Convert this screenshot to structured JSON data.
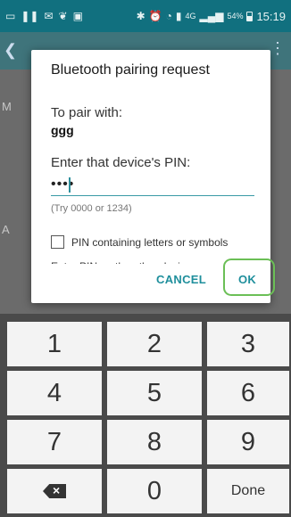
{
  "status_bar": {
    "left_icons": [
      "cast-icon",
      "pause-icon",
      "mail-icon",
      "leaf-icon",
      "screenshot-icon"
    ],
    "right_icons": [
      "bluetooth-icon",
      "alarm-icon",
      "wifi-icon",
      "sim-icon"
    ],
    "network": "4G",
    "battery": "54%",
    "time": "15:19"
  },
  "background": {
    "letter_m": "M",
    "letter_a": "A"
  },
  "dialog": {
    "title": "Bluetooth pairing request",
    "pair_label": "To pair with:",
    "device_name": "ggg",
    "pin_prompt": "Enter that device's PIN:",
    "pin_value": "••••",
    "hint": "(Try 0000 or 1234)",
    "checkbox_label": "PIN containing letters or symbols",
    "cutoff_text": "Enter PIN on the other device",
    "cancel_label": "CANCEL",
    "ok_label": "OK"
  },
  "keypad": {
    "keys": [
      "1",
      "2",
      "3",
      "4",
      "5",
      "6",
      "7",
      "8",
      "9",
      "",
      "0",
      "Done"
    ]
  }
}
